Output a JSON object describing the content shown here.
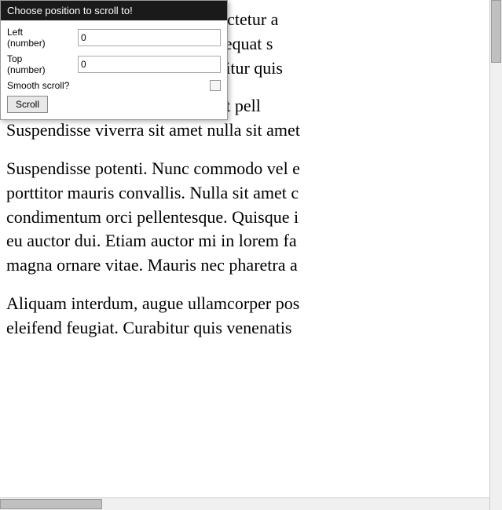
{
  "popup": {
    "header": "Choose position to scroll to!",
    "left_label": "Left\n(number)",
    "left_value": "0",
    "top_label": "Top\n(number)",
    "top_value": "0",
    "smooth_label": "Smooth scroll?",
    "scroll_btn": "Scroll"
  },
  "content": {
    "line1": "L                                sit amet, consectetur a",
    "line2": "p                                est tortor, consequat s",
    "line3": "d                                ristique. Curabitur quis",
    "line4": "D                        ero. Fusce sit amet pell",
    "line5": "Suspendisse viverra sit amet nulla sit amet",
    "line6": "",
    "line7": "Suspendisse potenti. Nunc commodo vel e",
    "line8": "porttitor mauris convallis. Nulla sit amet c",
    "line9": "condimentum orci pellentesque. Quisque i",
    "line10": "eu auctor dui. Etiam auctor mi in lorem fa",
    "line11": "magna ornare vitae. Mauris nec pharetra a",
    "line12": "",
    "line13": "Aliquam interdum, augue ullamcorper pos",
    "line14": "eleifend feugiat. Curabitur quis venenatis"
  }
}
